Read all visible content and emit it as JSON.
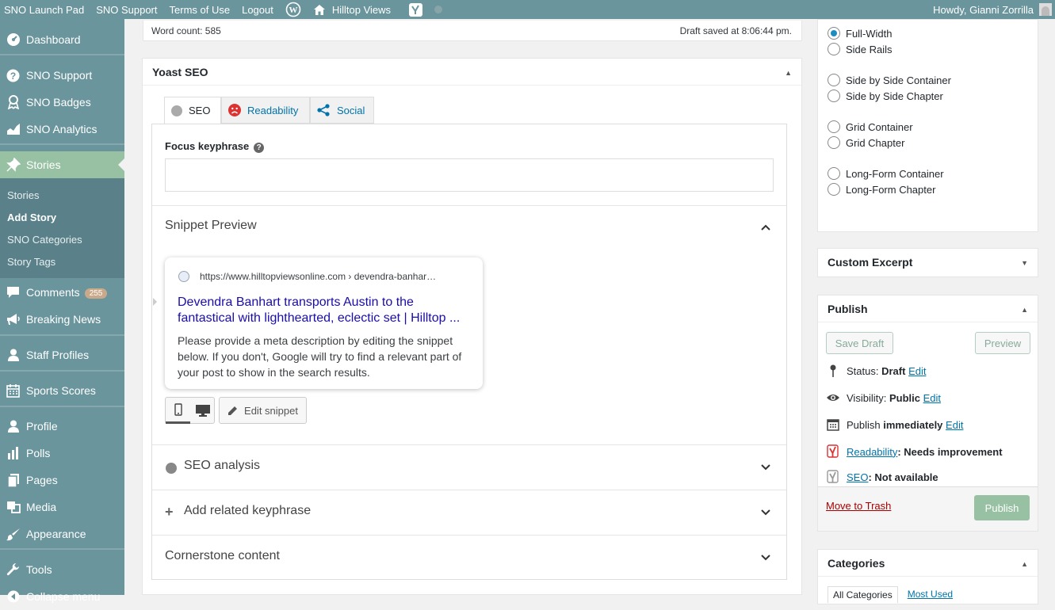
{
  "adminbar": {
    "items": [
      "SNO Launch Pad",
      "SNO Support",
      "Terms of Use",
      "Logout"
    ],
    "site_name": "Hilltop Views",
    "howdy": "Howdy, Gianni Zorrilla"
  },
  "sidebar": {
    "dashboard": "Dashboard",
    "sno_support": "SNO Support",
    "sno_badges": "SNO Badges",
    "sno_analytics": "SNO Analytics",
    "stories": "Stories",
    "sub": [
      "Stories",
      "Add Story",
      "SNO Categories",
      "Story Tags"
    ],
    "comments": "Comments",
    "comments_count": "255",
    "breaking_news": "Breaking News",
    "staff_profiles": "Staff Profiles",
    "sports_scores": "Sports Scores",
    "profile": "Profile",
    "polls": "Polls",
    "pages": "Pages",
    "media": "Media",
    "appearance": "Appearance",
    "tools": "Tools",
    "collapse": "Collapse menu"
  },
  "editor": {
    "word_count": "Word count: 585",
    "draft_saved": "Draft saved at 8:06:44 pm."
  },
  "yoast": {
    "title": "Yoast SEO",
    "tabs": [
      "SEO",
      "Readability",
      "Social"
    ],
    "focus_label": "Focus keyphrase",
    "focus_value": "",
    "snippet_title": "Snippet Preview",
    "snippet": {
      "url": "https://www.hilltopviewsonline.com › devendra-banhar…",
      "headline": "Devendra Banhart transports Austin to the fantastical with lighthearted, eclectic set | Hilltop ...",
      "description": "Please provide a meta description by editing the snippet below. If you don't, Google will try to find a relevant part of your post to show in the search results."
    },
    "edit_snippet": "Edit snippet",
    "seo_analysis": "SEO analysis",
    "add_related": "Add related keyphrase",
    "cornerstone": "Cornerstone content"
  },
  "layout_options": [
    "Full-Width",
    "Side Rails",
    "Side by Side Container",
    "Side by Side Chapter",
    "Grid Container",
    "Grid Chapter",
    "Long-Form Container",
    "Long-Form Chapter"
  ],
  "layout_selected": "Full-Width",
  "custom_excerpt": {
    "title": "Custom Excerpt"
  },
  "publish": {
    "title": "Publish",
    "save_draft": "Save Draft",
    "preview": "Preview",
    "status_label": "Status:",
    "status_value": "Draft",
    "visibility_label": "Visibility:",
    "visibility_value": "Public",
    "publish_label": "Publish",
    "publish_value": "immediately",
    "edit": "Edit",
    "readability_link": "Readability",
    "readability_value": ": Needs improvement",
    "seo_link": "SEO",
    "seo_value": ": Not available",
    "trash": "Move to Trash",
    "publish_button": "Publish"
  },
  "categories": {
    "title": "Categories",
    "tabs": [
      "All Categories",
      "Most Used"
    ]
  },
  "colors": {
    "adminbar": "#6a959d",
    "accent": "#98c1a4",
    "link": "#0073aa",
    "snippet_title": "#1a0dab",
    "readability_red": "#dc3232"
  }
}
